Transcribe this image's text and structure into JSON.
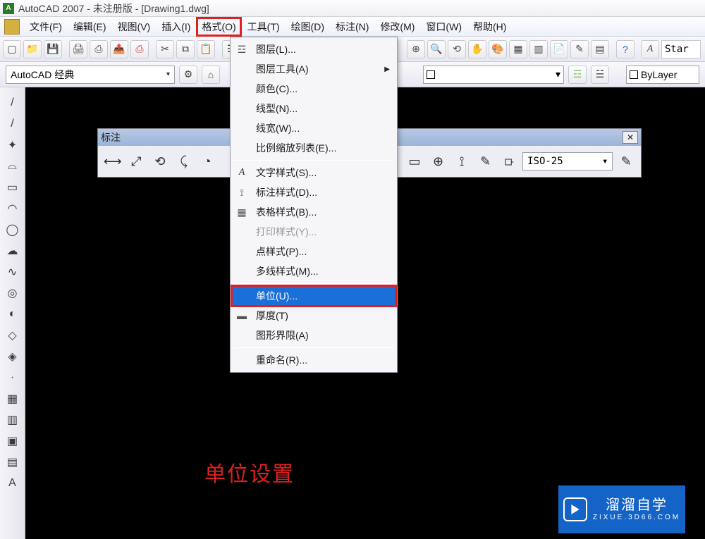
{
  "titlebar": {
    "text": "AutoCAD 2007 - 未注册版 - [Drawing1.dwg]"
  },
  "menubar": {
    "items": [
      "文件(F)",
      "编辑(E)",
      "视图(V)",
      "插入(I)",
      "格式(O)",
      "工具(T)",
      "绘图(D)",
      "标注(N)",
      "修改(M)",
      "窗口(W)",
      "帮助(H)"
    ],
    "highlighted_index": 4
  },
  "toolbar_right": {
    "style_label": "Star"
  },
  "layer_bar": {
    "combo_value": "AutoCAD 经典",
    "bylayer_label": "ByLayer"
  },
  "left_tools": [
    "/",
    "/",
    "✦",
    "⌓",
    "▭",
    "◠",
    "◯",
    "☁",
    "∿",
    "◎",
    "◐",
    "◇",
    "◈",
    "·",
    "▦",
    "▥",
    "▣",
    "▤",
    "A"
  ],
  "dim_toolbar": {
    "title": "标注",
    "combo_value": "ISO-25",
    "left_icons": [
      "⟷",
      "⤢",
      "⟲",
      "⤹",
      "◔"
    ],
    "right_icons": [
      "▭",
      "⊕",
      "⟟",
      "✎",
      "⟥"
    ]
  },
  "format_menu": {
    "items": [
      {
        "label": "图层(L)...",
        "icon": "layers"
      },
      {
        "label": "图层工具(A)",
        "submenu": true
      },
      {
        "label": "颜色(C)..."
      },
      {
        "label": "线型(N)..."
      },
      {
        "label": "线宽(W)..."
      },
      {
        "label": "比例缩放列表(E)..."
      },
      {
        "sep": true
      },
      {
        "label": "文字样式(S)...",
        "icon": "A"
      },
      {
        "label": "标注样式(D)...",
        "icon": "dim"
      },
      {
        "label": "表格样式(B)...",
        "icon": "table"
      },
      {
        "label": "打印样式(Y)...",
        "disabled": true
      },
      {
        "label": "点样式(P)..."
      },
      {
        "label": "多线样式(M)..."
      },
      {
        "sep": true
      },
      {
        "label": "单位(U)...",
        "selected": true,
        "highlighted": true
      },
      {
        "label": "厚度(T)",
        "icon": "thick"
      },
      {
        "label": "图形界限(A)"
      },
      {
        "sep": true
      },
      {
        "label": "重命名(R)..."
      }
    ]
  },
  "annotation": "单位设置",
  "watermark": {
    "main": "溜溜自学",
    "sub": "ZIXUE.3D66.COM"
  }
}
